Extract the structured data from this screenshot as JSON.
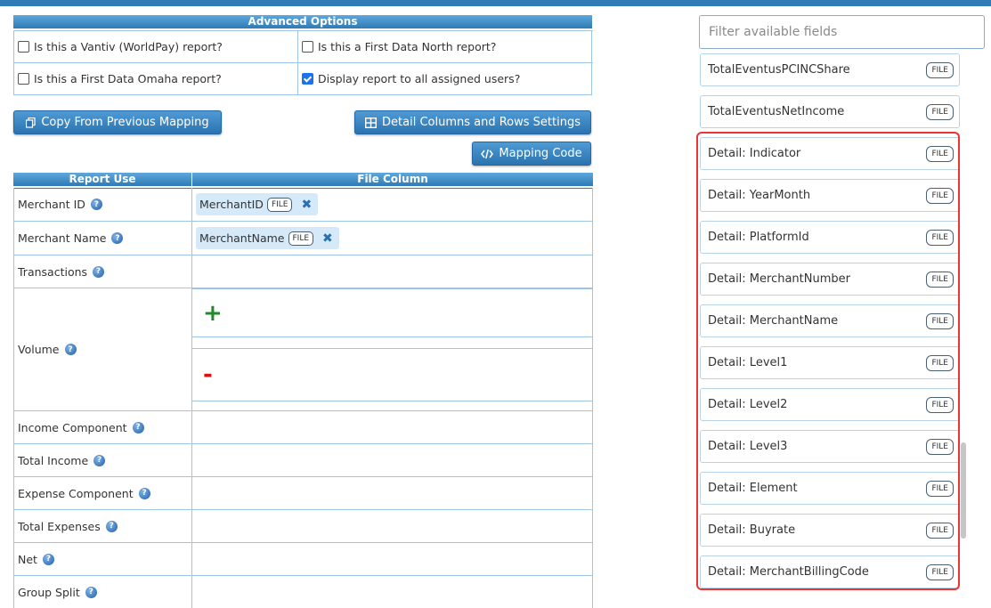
{
  "advanced": {
    "header": "Advanced Options",
    "options": [
      {
        "label": "Is this a Vantiv (WorldPay) report?",
        "checked": false
      },
      {
        "label": "Is this a First Data North report?",
        "checked": false
      },
      {
        "label": "Is this a First Data Omaha report?",
        "checked": false
      },
      {
        "label": "Display report to all assigned users?",
        "checked": true
      }
    ]
  },
  "buttons": {
    "copy": "Copy From Previous Mapping",
    "detail": "Detail Columns and Rows Settings",
    "code": "Mapping Code"
  },
  "mapping": {
    "header_left": "Report Use",
    "header_right": "File Column",
    "rows": [
      {
        "label": "Merchant ID",
        "chip": "MerchantID",
        "badge": "FILE"
      },
      {
        "label": "Merchant Name",
        "chip": "MerchantName",
        "badge": "FILE"
      },
      {
        "label": "Transactions"
      },
      {
        "label": "Volume"
      },
      {
        "label": "Income Component"
      },
      {
        "label": "Total Income"
      },
      {
        "label": "Expense Component"
      },
      {
        "label": "Total Expenses"
      },
      {
        "label": "Net"
      },
      {
        "label": "Group Split"
      }
    ],
    "volume_plus": "+",
    "volume_minus": "-"
  },
  "filter": {
    "placeholder": "Filter available fields"
  },
  "fields": [
    "TotalEventusPCINCShare",
    "TotalEventusNetIncome",
    "Detail: Indicator",
    "Detail: YearMonth",
    "Detail: PlatformId",
    "Detail: MerchantNumber",
    "Detail: MerchantName",
    "Detail: Level1",
    "Detail: Level2",
    "Detail: Level3",
    "Detail: Element",
    "Detail: Buyrate",
    "Detail: MerchantBillingCode"
  ],
  "badge_label": "FILE",
  "help_glyph": "?",
  "remove_glyph": "✖",
  "colors": {
    "accent": "#2e7bb5",
    "highlight": "#e33333",
    "plus": "#1f8b2a",
    "minus": "#dd1111"
  }
}
